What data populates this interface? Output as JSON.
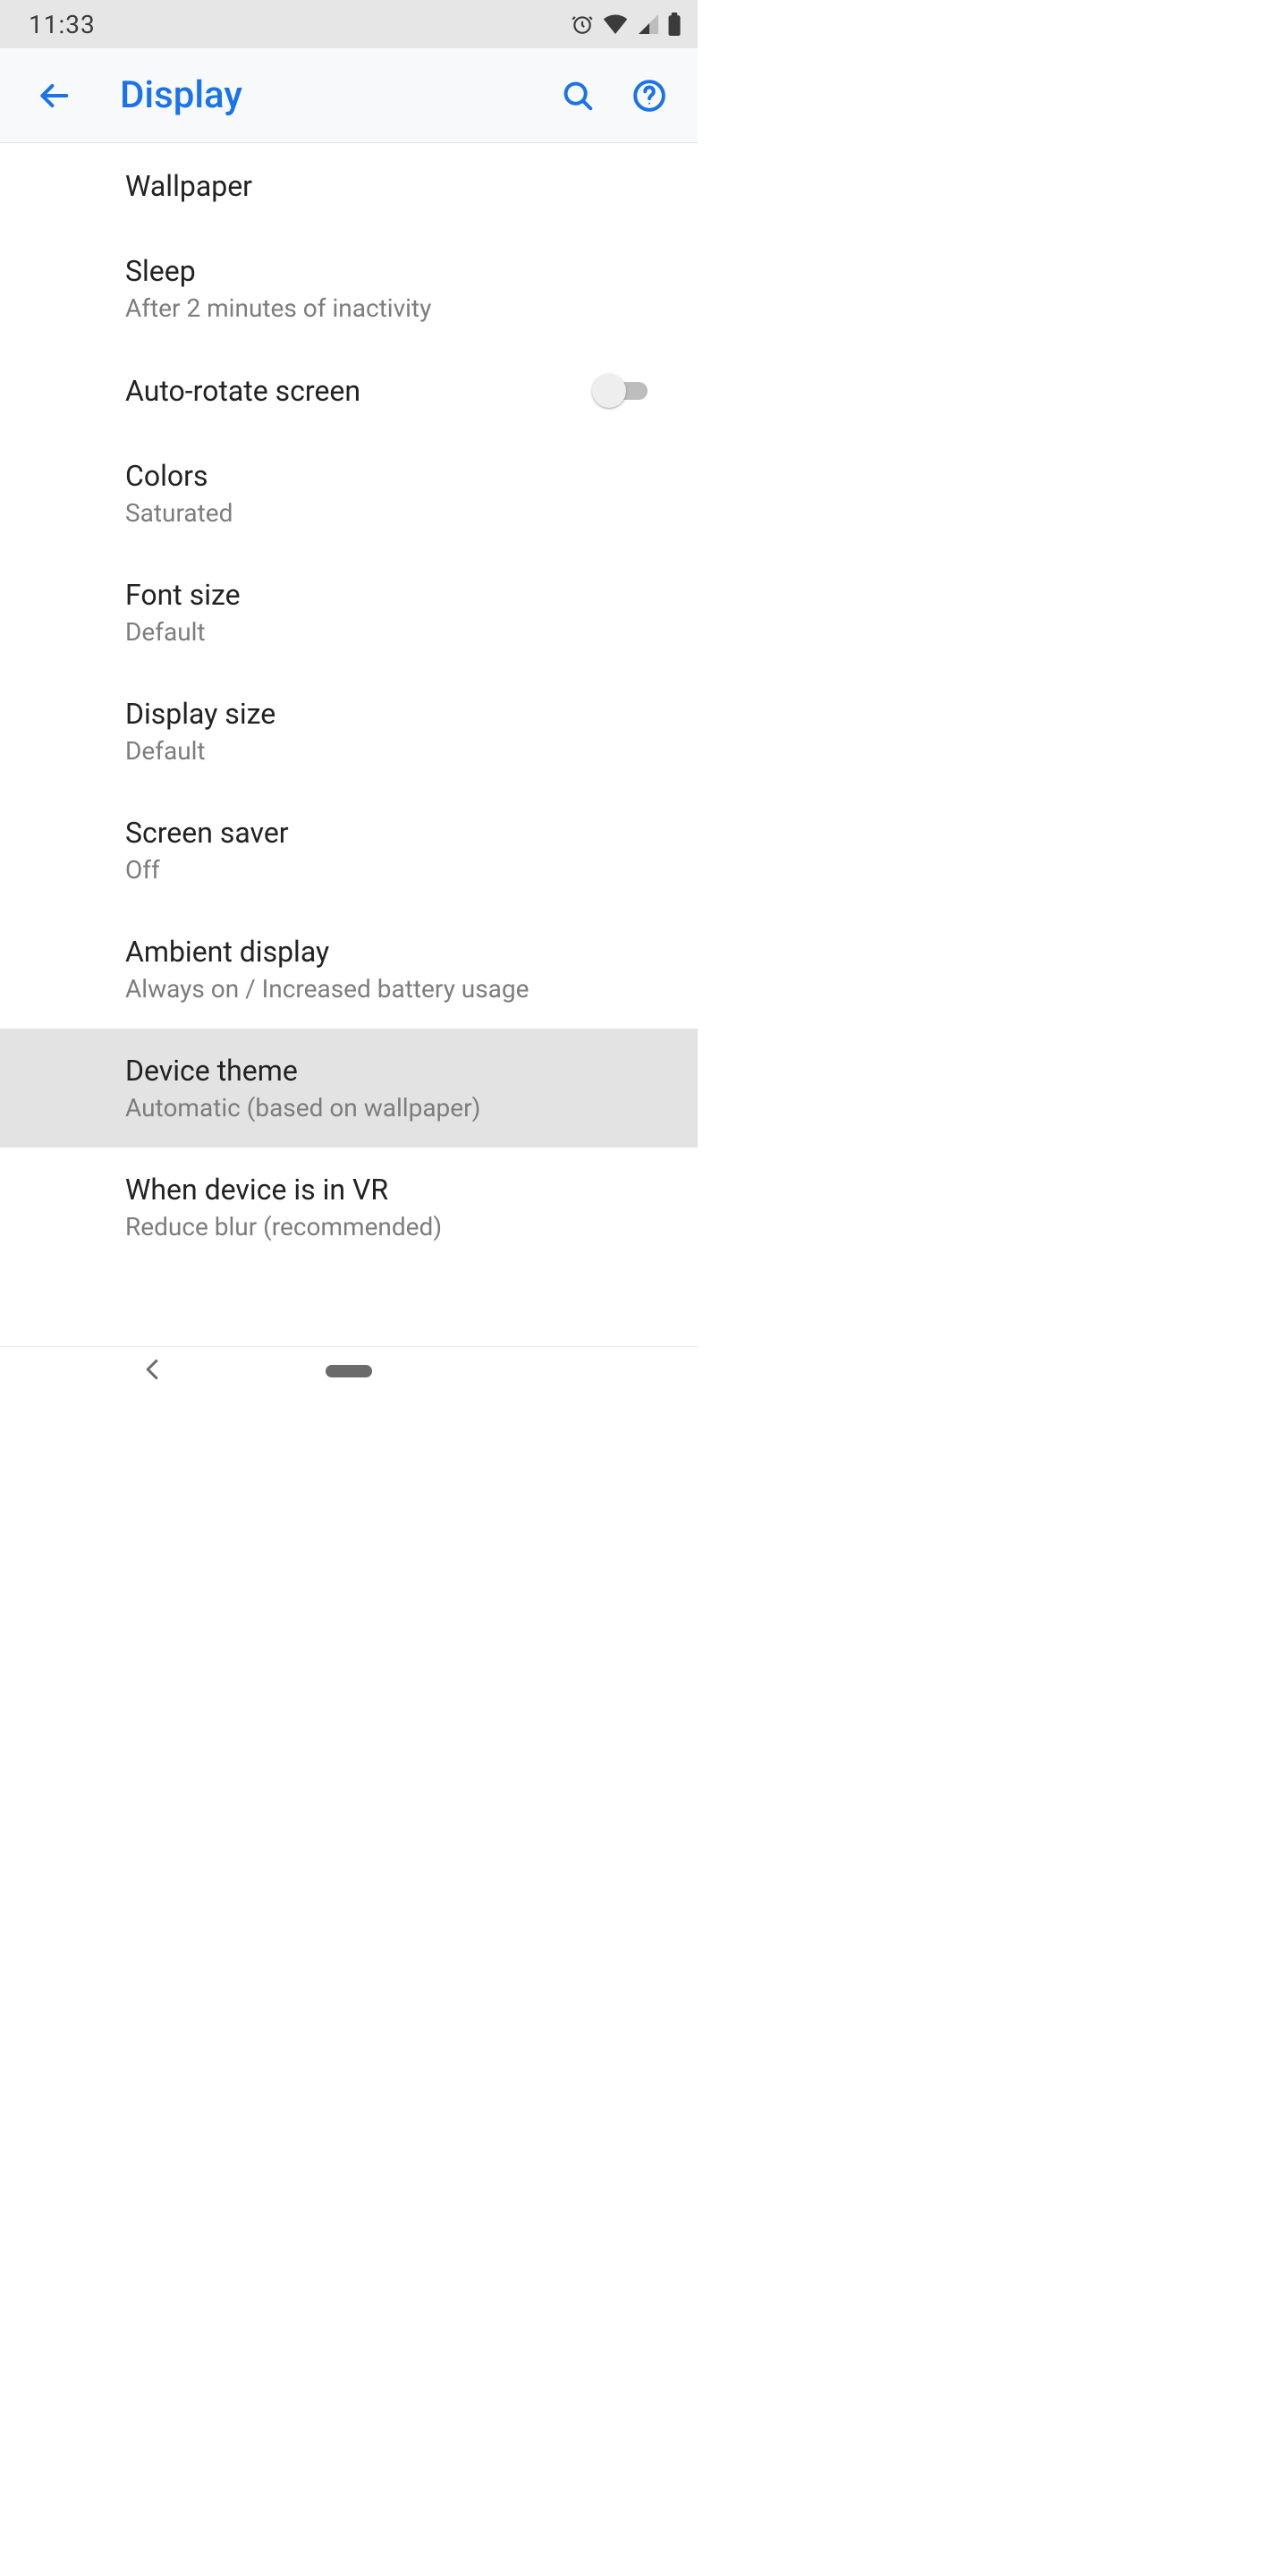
{
  "status": {
    "time": "11:33"
  },
  "appbar": {
    "title": "Display"
  },
  "items": [
    {
      "title": "Wallpaper",
      "subtitle": null,
      "toggle": false,
      "highlight": false,
      "name": "item-wallpaper"
    },
    {
      "title": "Sleep",
      "subtitle": "After 2 minutes of inactivity",
      "toggle": false,
      "highlight": false,
      "name": "item-sleep"
    },
    {
      "title": "Auto-rotate screen",
      "subtitle": null,
      "toggle": true,
      "toggle_on": false,
      "highlight": false,
      "name": "item-auto-rotate"
    },
    {
      "title": "Colors",
      "subtitle": "Saturated",
      "toggle": false,
      "highlight": false,
      "name": "item-colors"
    },
    {
      "title": "Font size",
      "subtitle": "Default",
      "toggle": false,
      "highlight": false,
      "name": "item-font-size"
    },
    {
      "title": "Display size",
      "subtitle": "Default",
      "toggle": false,
      "highlight": false,
      "name": "item-display-size"
    },
    {
      "title": "Screen saver",
      "subtitle": "Off",
      "toggle": false,
      "highlight": false,
      "name": "item-screen-saver"
    },
    {
      "title": "Ambient display",
      "subtitle": "Always on / Increased battery usage",
      "toggle": false,
      "highlight": false,
      "name": "item-ambient-display"
    },
    {
      "title": "Device theme",
      "subtitle": "Automatic (based on wallpaper)",
      "toggle": false,
      "highlight": true,
      "name": "item-device-theme"
    },
    {
      "title": "When device is in VR",
      "subtitle": "Reduce blur (recommended)",
      "toggle": false,
      "highlight": false,
      "name": "item-vr"
    }
  ],
  "colors": {
    "accent": "#1a73e8",
    "highlight": "#e3e3e3"
  }
}
